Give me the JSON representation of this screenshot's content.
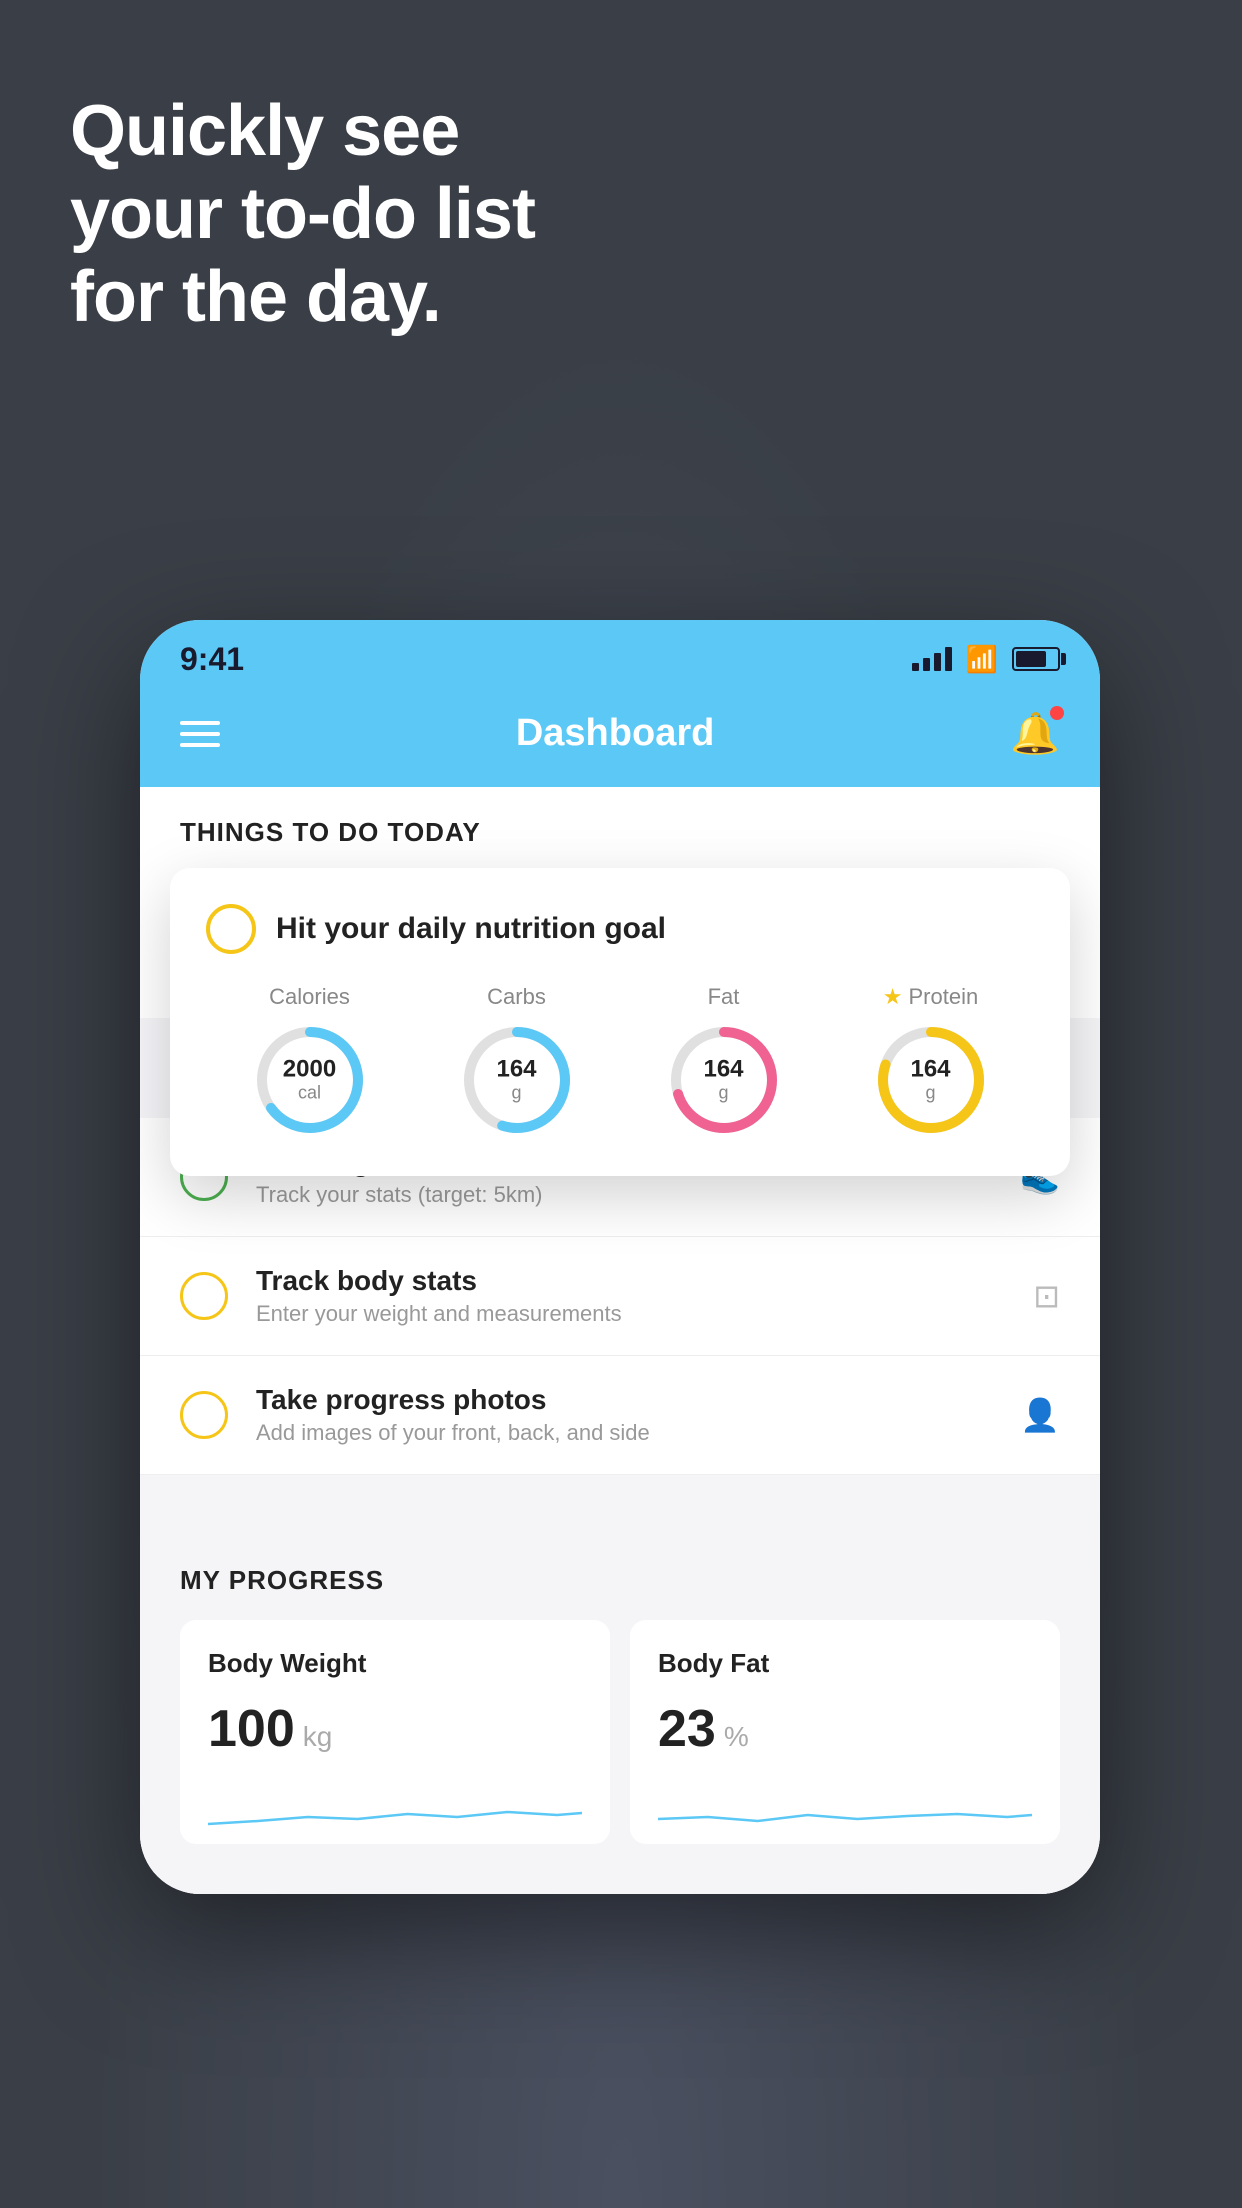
{
  "page": {
    "background_color": "#3a3f47"
  },
  "headline": {
    "line1": "Quickly see",
    "line2": "your to-do list",
    "line3": "for the day."
  },
  "phone": {
    "status_bar": {
      "time": "9:41"
    },
    "nav": {
      "title": "Dashboard"
    },
    "things_section": {
      "header": "THINGS TO DO TODAY"
    },
    "floating_card": {
      "circle_color": "#f5c518",
      "title": "Hit your daily nutrition goal",
      "nutrition": {
        "calories": {
          "label": "Calories",
          "value": "2000",
          "unit": "cal",
          "color": "#5bc8f5",
          "percent": 65
        },
        "carbs": {
          "label": "Carbs",
          "value": "164",
          "unit": "g",
          "color": "#5bc8f5",
          "percent": 55
        },
        "fat": {
          "label": "Fat",
          "value": "164",
          "unit": "g",
          "color": "#f06292",
          "percent": 70
        },
        "protein": {
          "label": "Protein",
          "value": "164",
          "unit": "g",
          "color": "#f5c518",
          "percent": 80
        }
      }
    },
    "todo_items": [
      {
        "id": "running",
        "circle_color": "green",
        "title": "Running",
        "subtitle": "Track your stats (target: 5km)",
        "icon": "shoe"
      },
      {
        "id": "body-stats",
        "circle_color": "yellow",
        "title": "Track body stats",
        "subtitle": "Enter your weight and measurements",
        "icon": "scale"
      },
      {
        "id": "progress-photos",
        "circle_color": "yellow",
        "title": "Take progress photos",
        "subtitle": "Add images of your front, back, and side",
        "icon": "person"
      }
    ],
    "progress": {
      "header": "MY PROGRESS",
      "body_weight": {
        "title": "Body Weight",
        "value": "100",
        "unit": "kg"
      },
      "body_fat": {
        "title": "Body Fat",
        "value": "23",
        "unit": "%"
      }
    }
  }
}
